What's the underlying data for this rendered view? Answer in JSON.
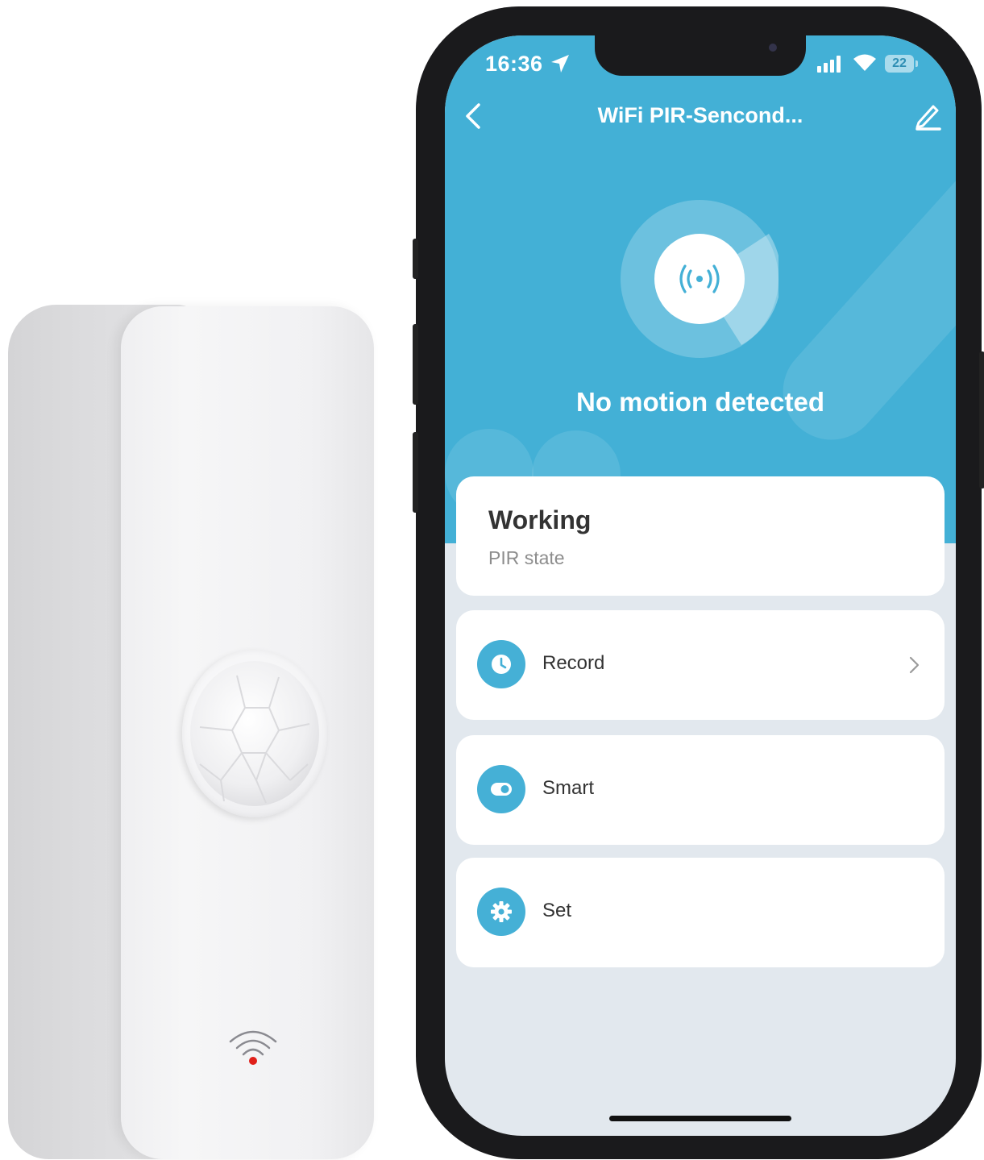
{
  "status_bar": {
    "time": "16:36",
    "battery": "22",
    "icons": [
      "location-arrow-icon",
      "cellular-signal-icon",
      "wifi-icon",
      "battery-icon"
    ]
  },
  "header": {
    "title": "WiFi PIR-Sencond...",
    "back_icon": "chevron-left-icon",
    "edit_icon": "pencil-icon"
  },
  "hero": {
    "icon": "motion-sensor-broadcast-icon",
    "status": "No motion detected"
  },
  "state_card": {
    "value": "Working",
    "label": "PIR state"
  },
  "menu": [
    {
      "label": "Record",
      "icon": "clock-icon",
      "has_chevron": true
    },
    {
      "label": "Smart",
      "icon": "toggle-icon",
      "has_chevron": false
    },
    {
      "label": "Set",
      "icon": "gear-icon",
      "has_chevron": false
    }
  ],
  "colors": {
    "accent": "#43b0d6",
    "background": "#e2e8ee",
    "card": "#ffffff",
    "text": "#333333",
    "muted": "#8d8d8d"
  }
}
